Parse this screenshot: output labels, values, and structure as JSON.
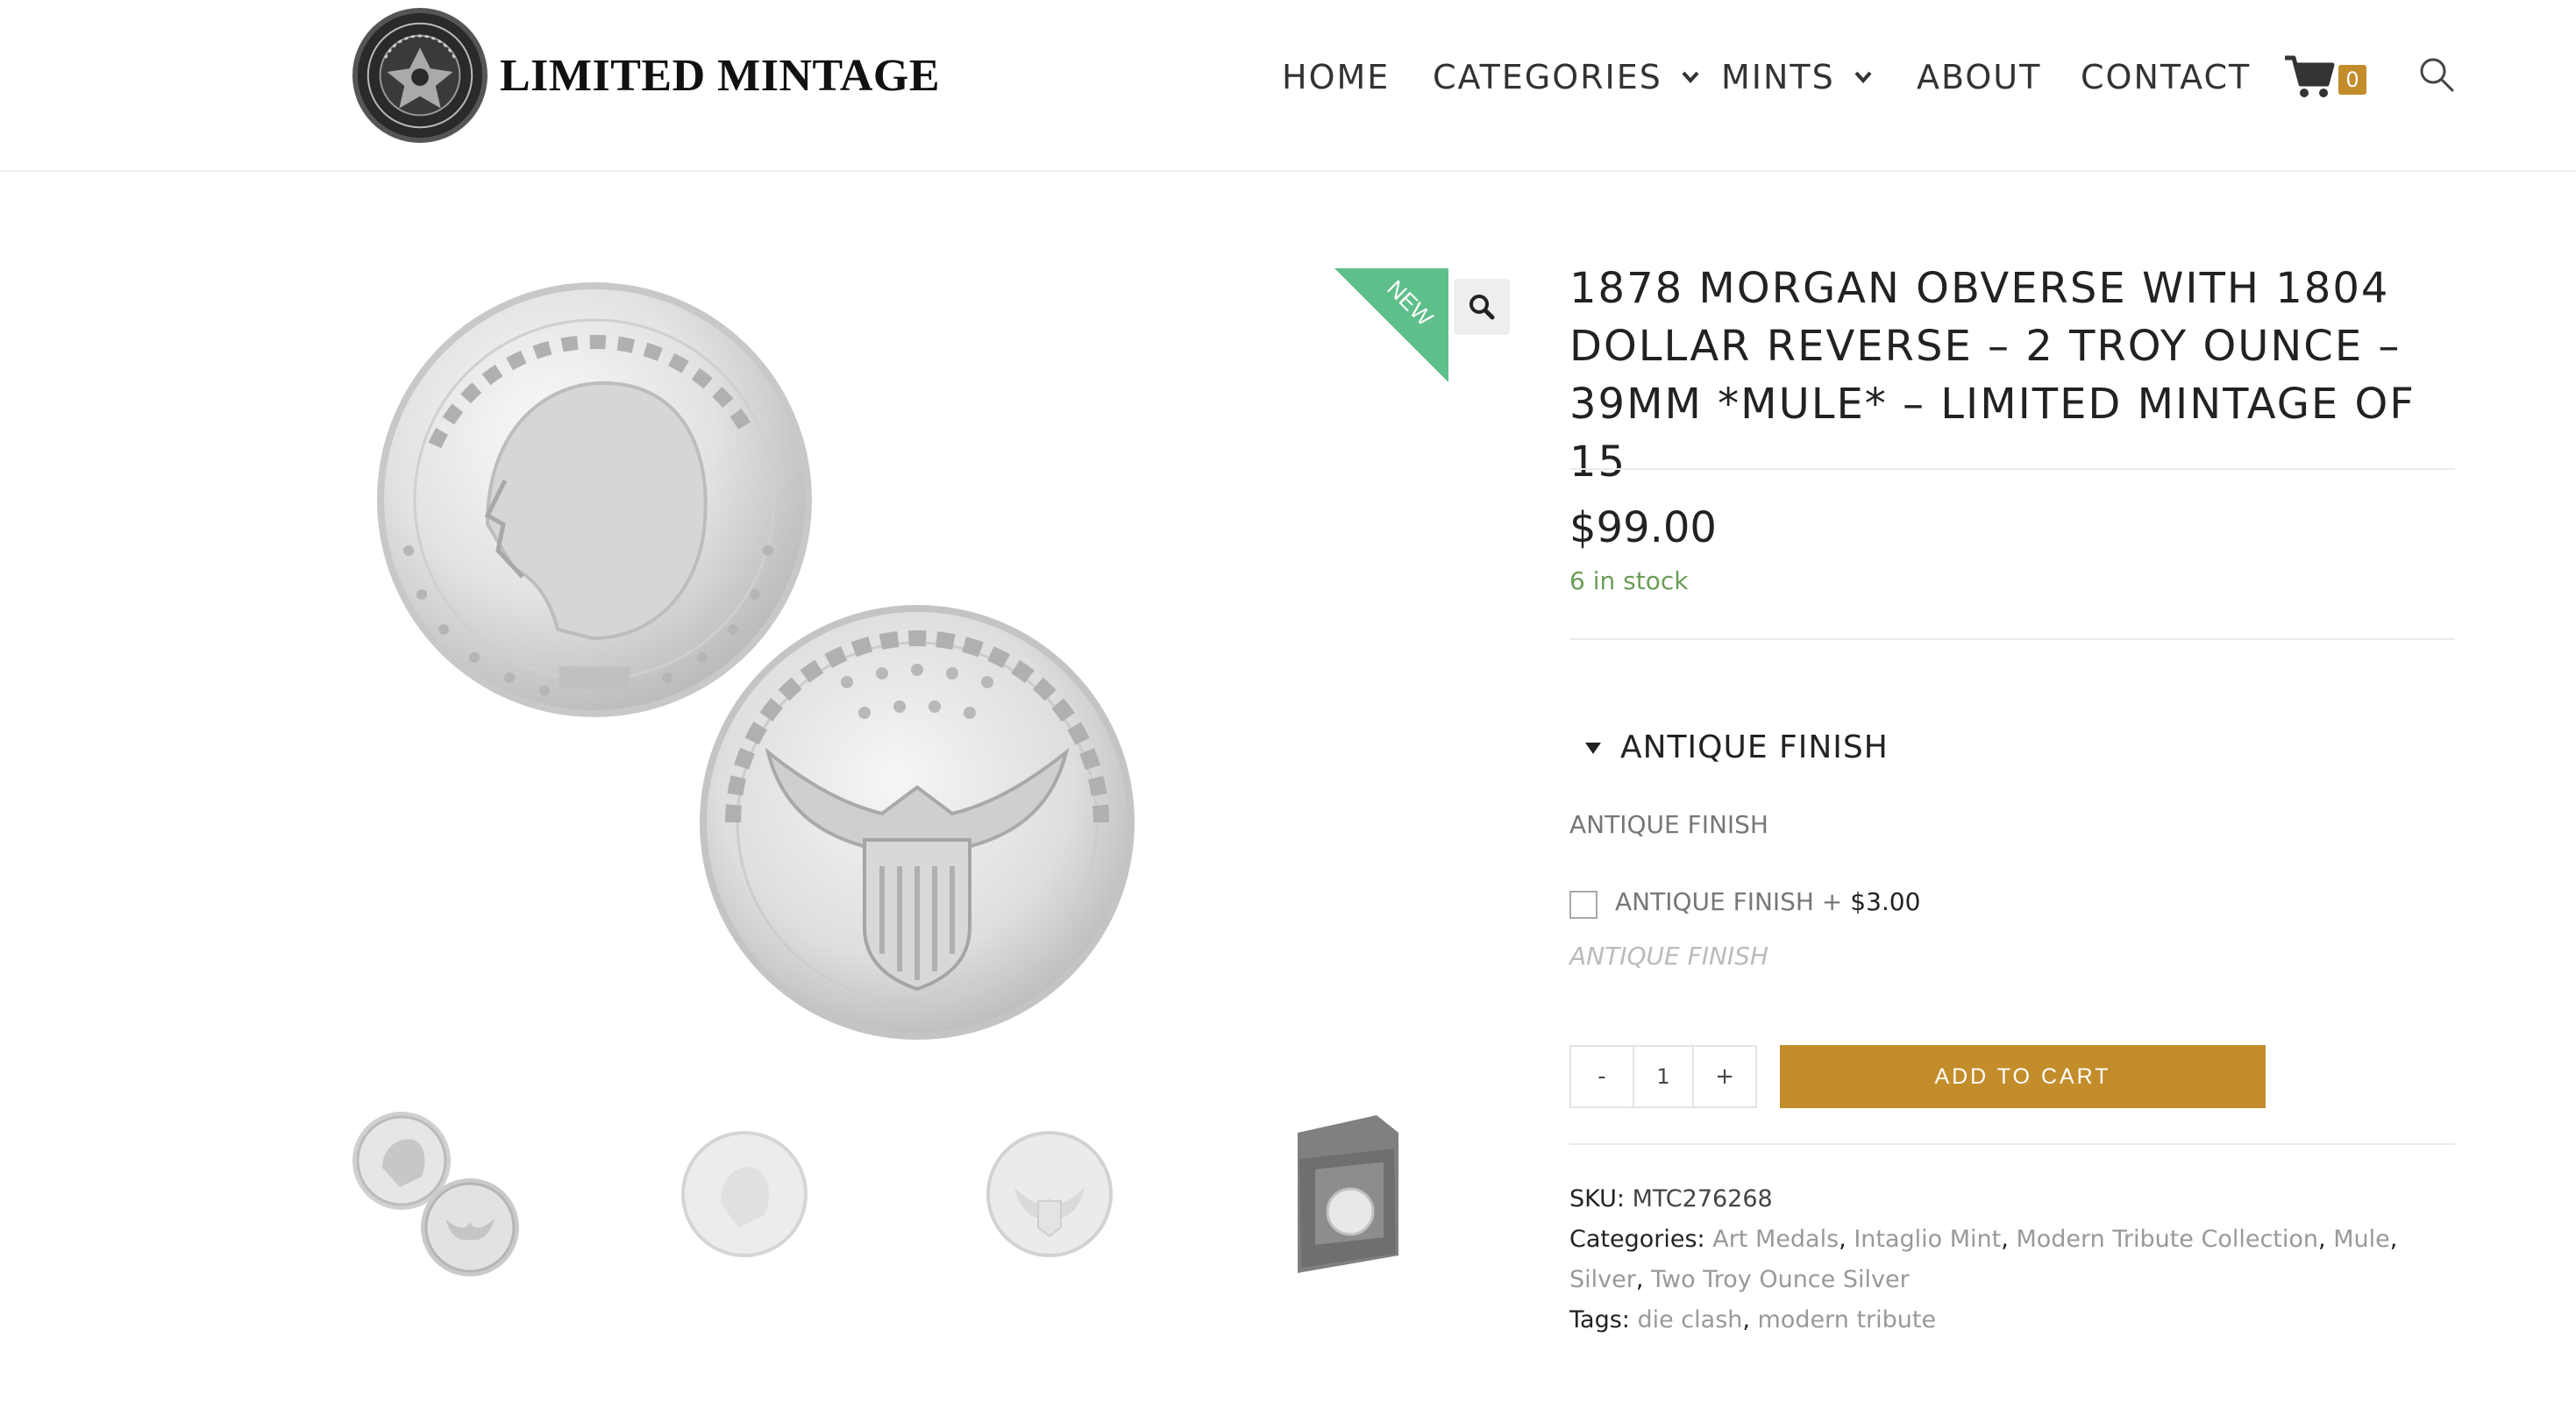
{
  "site": {
    "logo_text": "LIMITED MINTAGE"
  },
  "nav": {
    "home": "HOME",
    "categories": "CATEGORIES",
    "mints": "MINTS",
    "about": "ABOUT",
    "contact": "CONTACT",
    "cart_count": "0"
  },
  "gallery": {
    "badge": "NEW"
  },
  "product": {
    "title_lines": [
      "1878 MORGAN OBVERSE WITH 1804",
      "DOLLAR REVERSE – 2 TROY OUNCE –",
      "39MM *MULE* – LIMITED MINTAGE OF 15"
    ],
    "price": "$99.00",
    "stock": "6 in stock"
  },
  "option": {
    "heading": "ANTIQUE FINISH",
    "label": "ANTIQUE FINISH",
    "checkbox_label": "ANTIQUE FINISH + ",
    "checkbox_amount": "$3.00",
    "hint": "ANTIQUE FINISH"
  },
  "cart": {
    "minus": "-",
    "quantity": "1",
    "plus": "+",
    "add_label": "ADD TO CART"
  },
  "meta": {
    "sku_label": "SKU:",
    "sku_value": "MTC276268",
    "categories_label": "Categories:",
    "categories": [
      "Art Medals",
      "Intaglio Mint",
      "Modern Tribute Collection",
      "Mule",
      "Silver",
      "Two Troy Ounce Silver"
    ],
    "tags_label": "Tags:",
    "tags": [
      "die clash",
      "modern tribute"
    ]
  },
  "colors": {
    "accent": "#c38d2c",
    "ribbon": "#5fbf8a",
    "stock": "#6b9d57"
  }
}
